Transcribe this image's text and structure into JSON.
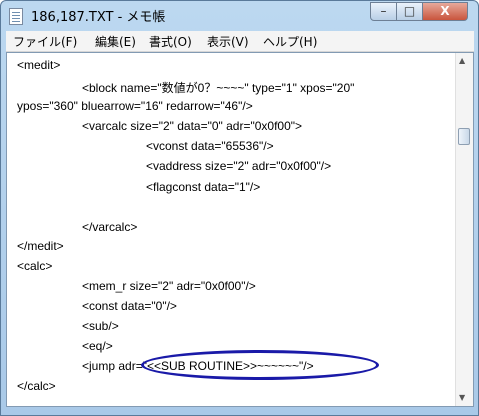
{
  "window": {
    "title": "186,187.TXT - メモ帳",
    "minimize": "–",
    "maximize": "□",
    "close": "X"
  },
  "menu": [
    "ファイル(F)",
    "編集(E)",
    "書式(O)",
    "表示(V)",
    "ヘルプ(H)"
  ],
  "editor": {
    "lines": [
      "<medit>",
      "<block name=\"数値が0？~~~~\" type=\"1\" xpos=\"20\"",
      "ypos=\"360\" bluearrow=\"16\" redarrow=\"46\"/>",
      "<varcalc size=\"2\" data=\"0\" adr=\"0x0f00\">",
      "<vconst data=\"65536\"/>",
      "<vaddress size=\"2\" adr=\"0x0f00\"/>",
      "<flagconst data=\"1\"/>",
      "</varcalc>",
      "</medit>",
      "<calc>",
      "<mem_r size=\"2\" adr=\"0x0f00\"/>",
      "<const data=\"0\"/>",
      "<sub/>",
      "<eq/>",
      "<jump adr=\"<<SUB ROUTINE>>~~~~~~\"/>",
      "</calc>"
    ]
  },
  "scrollbar": {
    "up_arrow": "▲",
    "down_arrow": "▼"
  }
}
